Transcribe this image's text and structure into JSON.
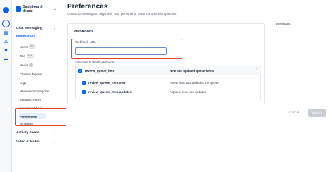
{
  "app": {
    "name": "Dashboard-demo"
  },
  "sidebar": {
    "chat_messaging": "Chat Messaging",
    "moderation": "Moderation",
    "mod_items": [
      {
        "label": "Users",
        "count": "31"
      },
      {
        "label": "Text",
        "count": "161"
      },
      {
        "label": "Media",
        "count": "0"
      }
    ],
    "links": [
      "Channel Explorer",
      "Logs",
      "Moderation Categories",
      "Semantic Filters",
      "Advanced Filters"
    ],
    "preferences": "Preferences",
    "templates": "Templates",
    "activity_feeds": "Activity Feeds",
    "video_audio": "Video & Audio"
  },
  "page": {
    "title": "Preferences",
    "subtitle": "Customize settings to align with your personal or team's moderation policies."
  },
  "webhooks": {
    "title": "Webhooks",
    "url_label": "Webhook URL",
    "url_value": "",
    "subscribe_label": "Subscribe to Webhook Events",
    "group": {
      "name": "review_queue_item",
      "desc": "New and updated queue items"
    },
    "events": [
      {
        "name": "review_queue_item.new",
        "desc": "A new item was added to the queue"
      },
      {
        "name": "review_queue_item.updated",
        "desc": "A queue item was updated"
      }
    ]
  },
  "right_nav": {
    "item": "Webhooks"
  },
  "footer": {
    "cancel": "Cancel",
    "submit": "Submit"
  },
  "colors": {
    "accent": "#005fff",
    "highlight": "#e2432f"
  }
}
